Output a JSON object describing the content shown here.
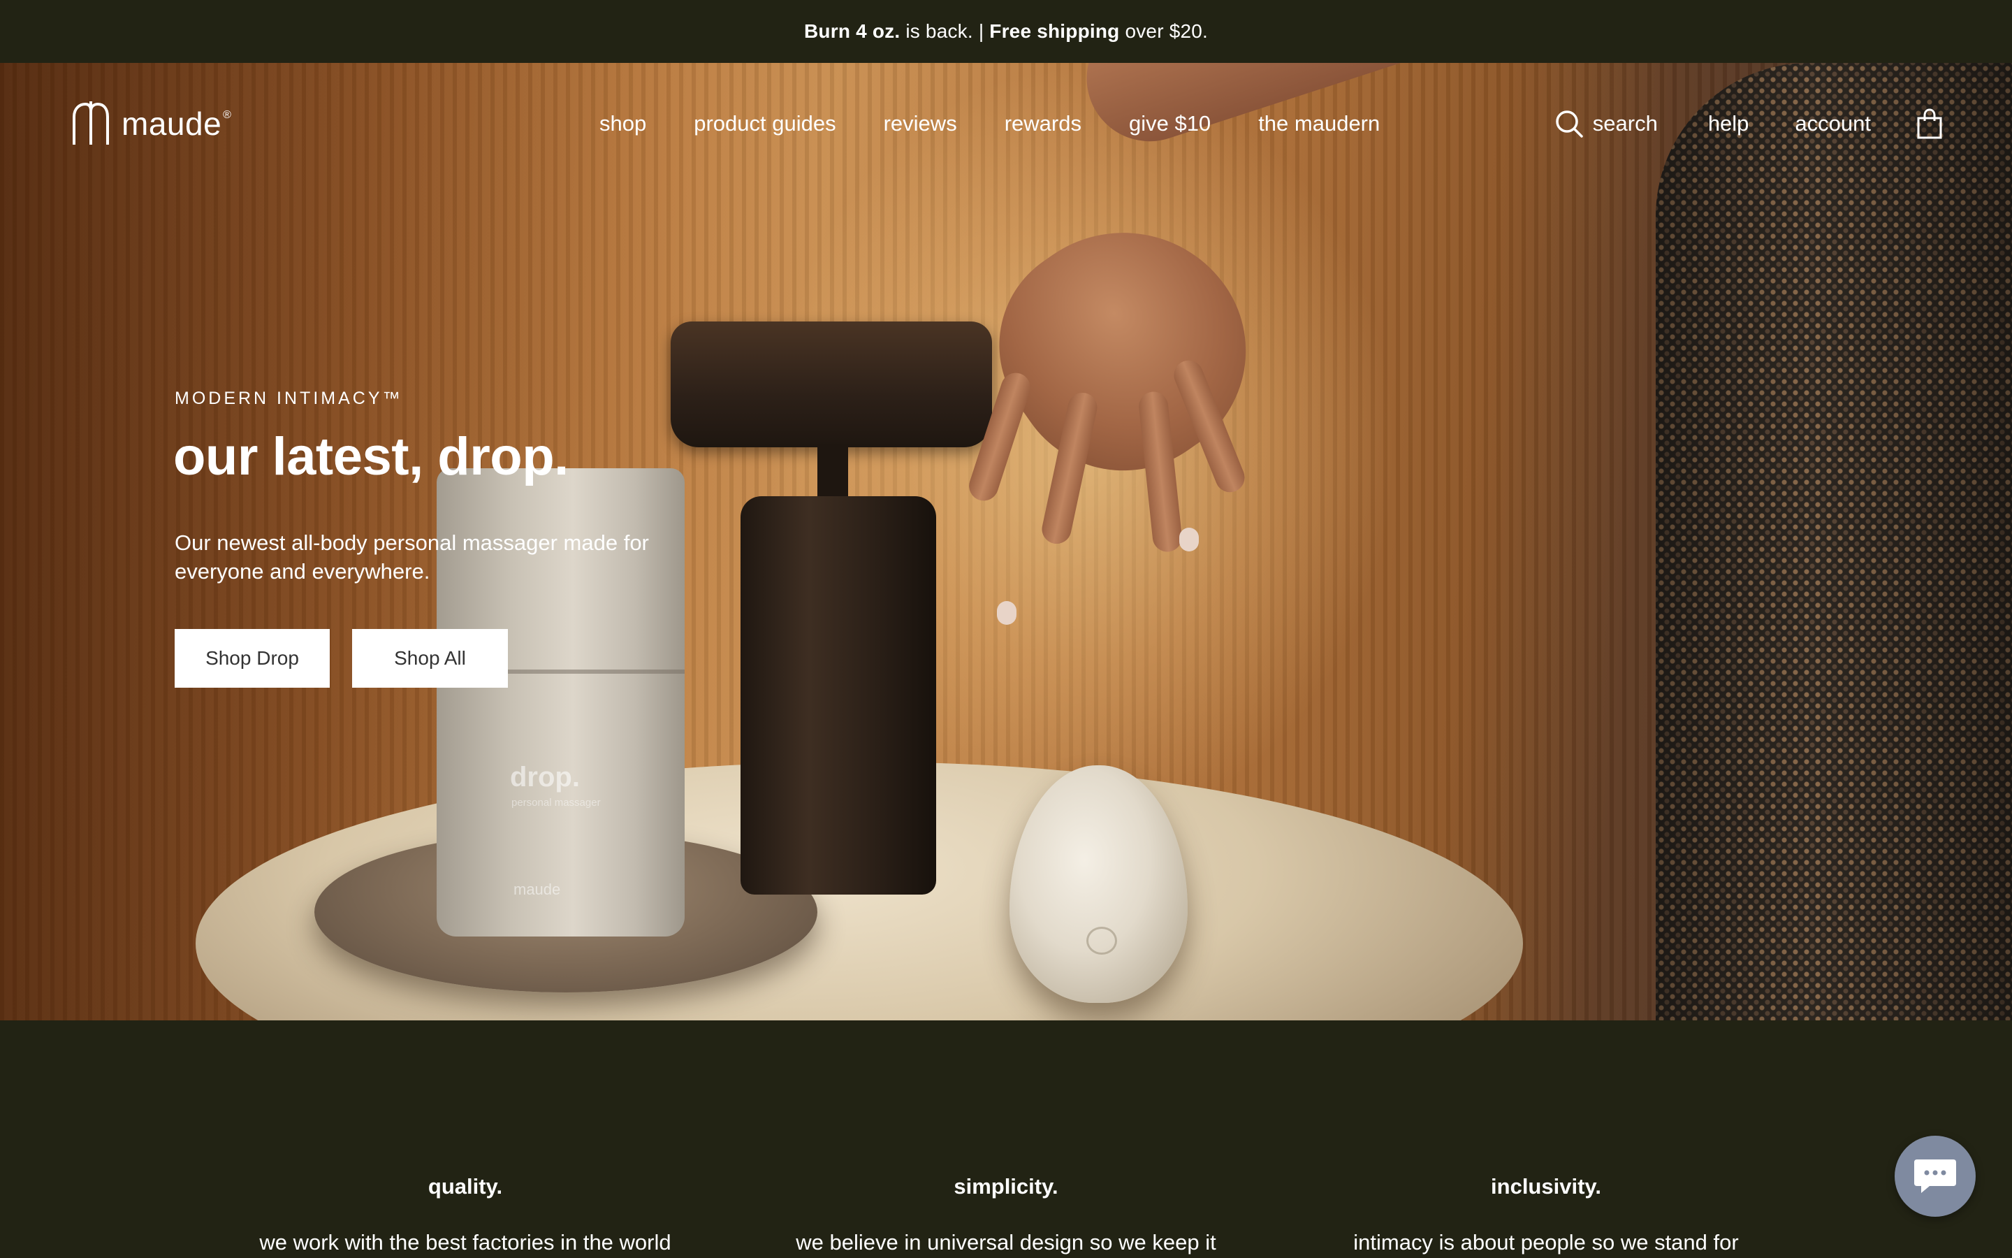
{
  "announcement": {
    "part1_bold": "Burn 4 oz.",
    "part1_rest": " is back. | ",
    "part2_bold": "Free shipping",
    "part2_rest": " over $20."
  },
  "header": {
    "brand": "maude",
    "brand_mark": "®",
    "nav": [
      "shop",
      "product guides",
      "reviews",
      "rewards",
      "give $10",
      "the maudern"
    ],
    "search_label": "search",
    "help_label": "help",
    "account_label": "account",
    "icons": {
      "search": "search-icon",
      "cart": "shopping-bag-icon",
      "logo": "maude-logo-icon",
      "chat": "chat-icon"
    }
  },
  "hero": {
    "eyebrow": "MODERN INTIMACY™",
    "headline": "our latest, drop.",
    "subcopy": "Our newest all-body personal massager made for everyone and everywhere.",
    "buttons": [
      "Shop Drop",
      "Shop All"
    ],
    "product_label": "drop.",
    "product_sub": "personal massager",
    "product_brand": "maude"
  },
  "values": [
    {
      "title": "quality.",
      "text": "we work with the best factories in the world"
    },
    {
      "title": "simplicity.",
      "text": "we believe in universal design so we keep it"
    },
    {
      "title": "inclusivity.",
      "text": "intimacy is about people so we stand for"
    }
  ],
  "colors": {
    "background": "#222314",
    "button_bg": "#ffffff",
    "chat_bubble": "#7f8aa0"
  }
}
